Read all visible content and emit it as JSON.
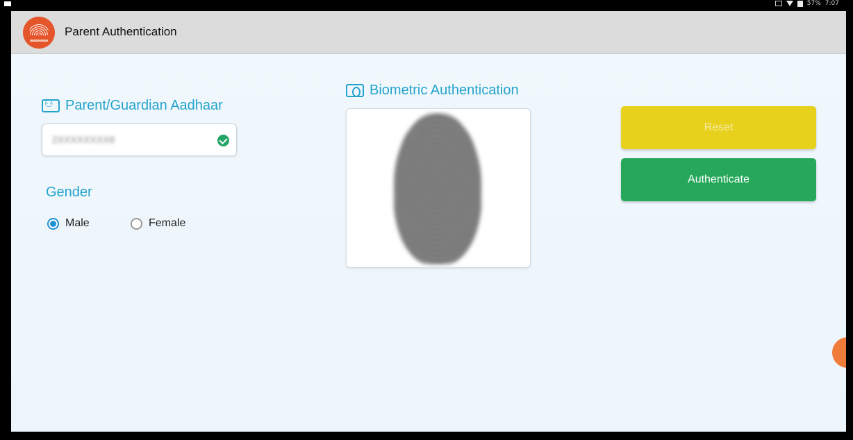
{
  "status_bar": {
    "time": "7:07",
    "battery": "57%"
  },
  "app_bar": {
    "title": "Parent Authentication",
    "logo_icon": "aadhaar-logo"
  },
  "aadhaar_section": {
    "title": "Parent/Guardian Aadhaar",
    "icon": "contacts-icon",
    "input_value": "2XXXXXXXX8",
    "valid_icon": "check-circle-icon"
  },
  "gender": {
    "label": "Gender",
    "options": [
      {
        "label": "Male",
        "selected": true
      },
      {
        "label": "Female",
        "selected": false
      }
    ]
  },
  "biometric_section": {
    "title": "Biometric Authentication",
    "icon": "fingerprint-icon"
  },
  "actions": {
    "reset_label": "Reset",
    "authenticate_label": "Authenticate"
  },
  "colors": {
    "accent": "#24a3cc",
    "reset": "#e8d11d",
    "authenticate": "#25a85a",
    "logo": "#e5552b"
  }
}
